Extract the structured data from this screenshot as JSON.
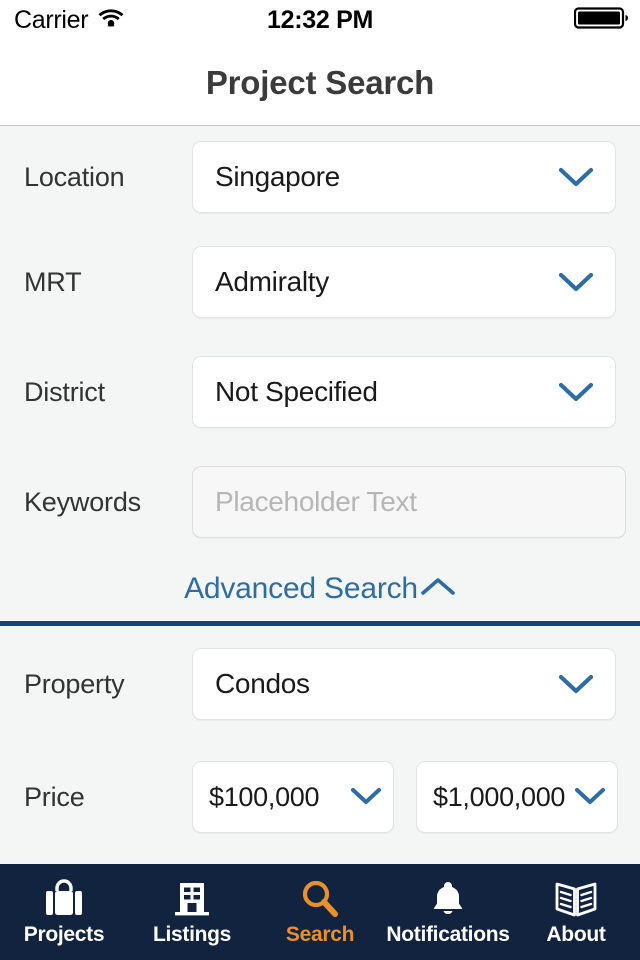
{
  "status_bar": {
    "carrier": "Carrier",
    "wifi_icon": "wifi-icon",
    "time": "12:32 PM",
    "battery_icon": "battery-full-icon"
  },
  "header": {
    "title": "Project Search"
  },
  "form": {
    "rows": [
      {
        "label": "Location",
        "value": "Singapore",
        "type": "select"
      },
      {
        "label": "MRT",
        "value": "Admiralty",
        "type": "select"
      },
      {
        "label": "District",
        "value": "Not Specified",
        "type": "select"
      },
      {
        "label": "Keywords",
        "placeholder": "Placeholder Text",
        "type": "text"
      }
    ]
  },
  "advanced": {
    "label": "Advanced Search",
    "chevron_icon": "chevron-up-icon",
    "expanded": true,
    "divider_color": "#114481",
    "rows": [
      {
        "label": "Property",
        "value": "Condos",
        "type": "select"
      }
    ],
    "price": {
      "label": "Price",
      "min": "$100,000",
      "max": "$1,000,000"
    }
  },
  "tabbar": {
    "background": "#11233f",
    "active_color": "#e8902a",
    "inactive_color": "#ffffff",
    "tabs": [
      {
        "label": "Projects",
        "icon": "briefcase-icon",
        "active": false
      },
      {
        "label": "Listings",
        "icon": "building-icon",
        "active": false
      },
      {
        "label": "Search",
        "icon": "magnifying-glass-icon",
        "active": true
      },
      {
        "label": "Notifications",
        "icon": "bell-icon",
        "active": false
      },
      {
        "label": "About",
        "icon": "open-book-icon",
        "active": false
      }
    ]
  },
  "theme": {
    "accent_blue": "#2e6da4",
    "navy": "#114481",
    "page_bg": "#f4f5f5"
  }
}
